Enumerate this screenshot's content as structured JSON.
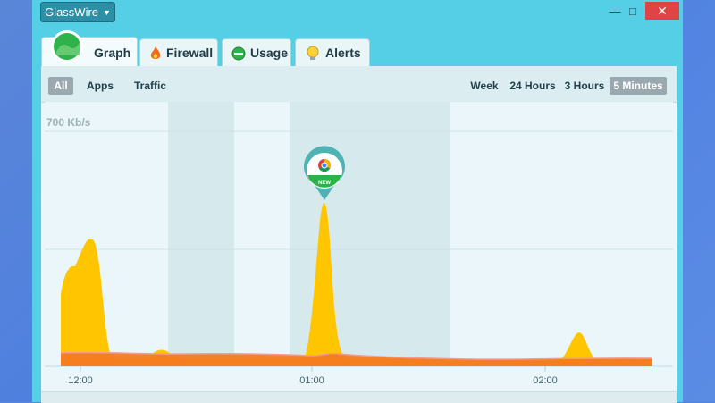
{
  "app": {
    "menu_label": "GlassWire"
  },
  "window_controls": {
    "minimize": "—",
    "maximize": "□",
    "close": "✕"
  },
  "tabs": [
    {
      "label": "Graph",
      "icon": "graph-logo-icon"
    },
    {
      "label": "Firewall",
      "icon": "flame-icon"
    },
    {
      "label": "Usage",
      "icon": "usage-icon"
    },
    {
      "label": "Alerts",
      "icon": "alert-bulb-icon"
    }
  ],
  "filters": {
    "all": "All",
    "apps": "Apps",
    "traffic": "Traffic"
  },
  "ranges": {
    "week": "Week",
    "hours24": "24 Hours",
    "hours3": "3 Hours",
    "minutes5": "5 Minutes",
    "selected": "5 Minutes"
  },
  "graph": {
    "scale_label": "700 Kb/s",
    "time_ticks": [
      "12:00",
      "01:00",
      "02:00"
    ],
    "marker_badge": "NEW",
    "marker_app_icon": "chrome-icon",
    "colors": {
      "incoming": "#ffc600",
      "outgoing": "#f47b20",
      "highlight": "#d3e8ec",
      "marker": "#4fb3b3",
      "badge": "#2bb34a"
    }
  }
}
